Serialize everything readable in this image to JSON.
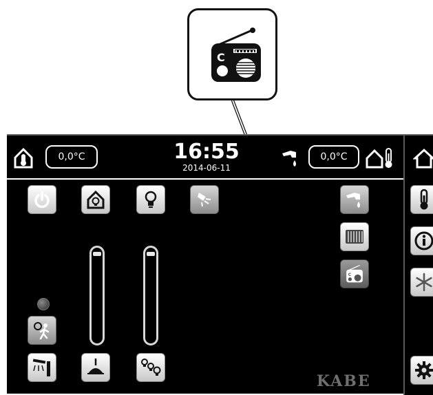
{
  "header": {
    "inside_temperature": "0,0°C",
    "outside_temperature": "0,0°C",
    "time": "16:55",
    "date": "2014-06-11"
  },
  "brand": "KABE",
  "sliders": [
    {
      "name": "dimmer-1",
      "level": 1.0
    },
    {
      "name": "dimmer-2",
      "level": 1.0
    }
  ],
  "icons": {
    "callout": "radio-icon",
    "left_header": "home-thermometer-icon",
    "water": "water-tap-icon",
    "right_header": "outdoor-thermometer-icon",
    "sidebar": [
      "home-icon",
      "thermometer-icon",
      "info-icon",
      "snowflake-icon",
      "gear-icon"
    ]
  },
  "colors": {
    "screen_background": "#000000",
    "button_light": "#e6e6e6",
    "button_gray": "#8d8d8d"
  }
}
